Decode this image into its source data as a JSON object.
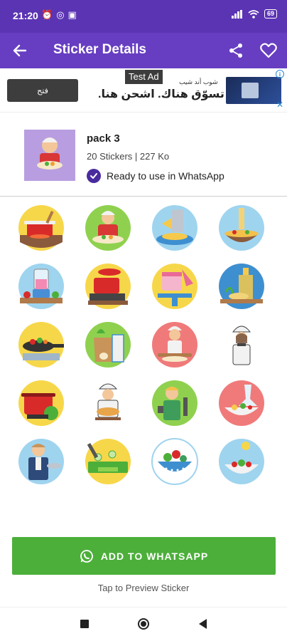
{
  "status_bar": {
    "time": "21:20",
    "battery": "69"
  },
  "app_bar": {
    "title": "Sticker Details"
  },
  "ad": {
    "badge": "Test Ad",
    "button_label": "فتح",
    "small_text": "شوب أند شيب",
    "headline": "تسوّق هناك. اشحن هنا."
  },
  "pack": {
    "name": "pack 3",
    "meta": "20 Stickers | 227 Ko",
    "status": "Ready to use in WhatsApp"
  },
  "stickers": [
    {
      "name": "cooking-pot-sticker"
    },
    {
      "name": "chef-serving-sticker"
    },
    {
      "name": "cheese-grater-sticker"
    },
    {
      "name": "pasta-bowl-sticker"
    },
    {
      "name": "blender-sticker"
    },
    {
      "name": "boiling-pot-sticker"
    },
    {
      "name": "cake-icing-sticker"
    },
    {
      "name": "oil-bottle-sticker"
    },
    {
      "name": "frying-pan-sticker"
    },
    {
      "name": "groceries-sticker"
    },
    {
      "name": "baker-rolling-sticker"
    },
    {
      "name": "woman-chef-sticker"
    },
    {
      "name": "soup-pot-sticker"
    },
    {
      "name": "chef-with-pie-sticker"
    },
    {
      "name": "cook-with-spatula-sticker"
    },
    {
      "name": "salad-bowl-sticker"
    },
    {
      "name": "waiter-sticker"
    },
    {
      "name": "chopping-board-sticker"
    },
    {
      "name": "colander-sticker"
    },
    {
      "name": "fresh-salad-sticker"
    }
  ],
  "actions": {
    "add_label": "ADD TO WHATSAPP",
    "preview_hint": "Tap to Preview Sticker"
  },
  "colors": {
    "status_bar": "#5b34b3",
    "app_bar": "#673ec1",
    "add_button": "#4caf3a"
  }
}
